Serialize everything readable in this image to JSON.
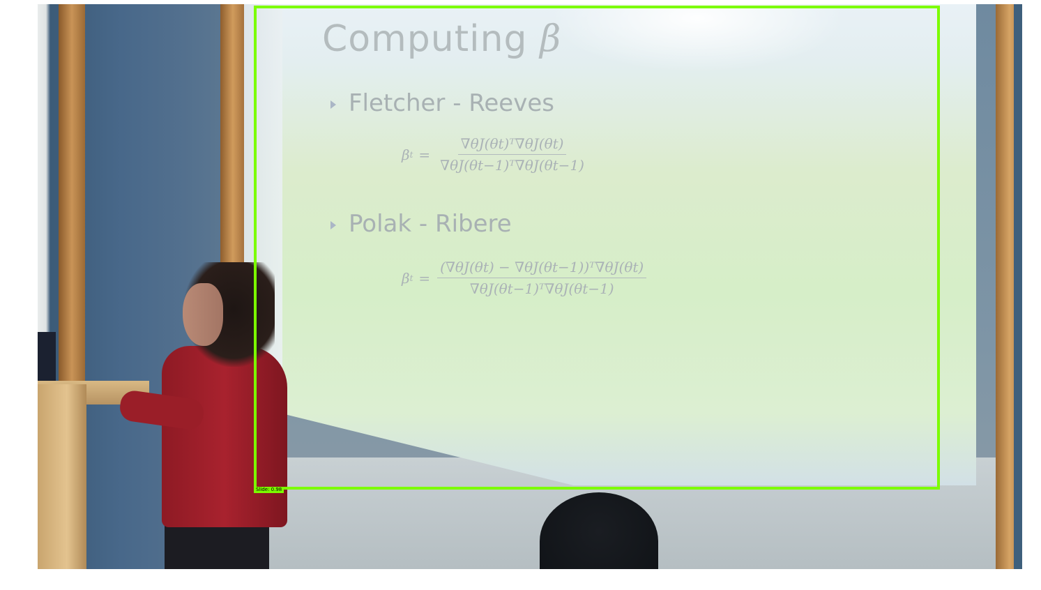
{
  "slide": {
    "title": "Computing",
    "title_symbol": "β",
    "bullet_1": "Fletcher - Reeves",
    "formula_1": {
      "lhs": "β",
      "lhs_sub": "t",
      "eq": "=",
      "numerator": "∇θJ(θt)ᵀ∇θJ(θt)",
      "denominator": "∇θJ(θt−1)ᵀ∇θJ(θt−1)"
    },
    "bullet_2": "Polak - Ribere",
    "formula_2": {
      "lhs": "β",
      "lhs_sub": "t",
      "eq": "=",
      "numerator": "(∇θJ(θt) − ∇θJ(θt−1))ᵀ∇θJ(θt)",
      "denominator": "∇θJ(θt−1)ᵀ∇θJ(θt−1)"
    }
  },
  "detection": {
    "label": "Slide: 0.98",
    "color": "#7cfc00"
  }
}
